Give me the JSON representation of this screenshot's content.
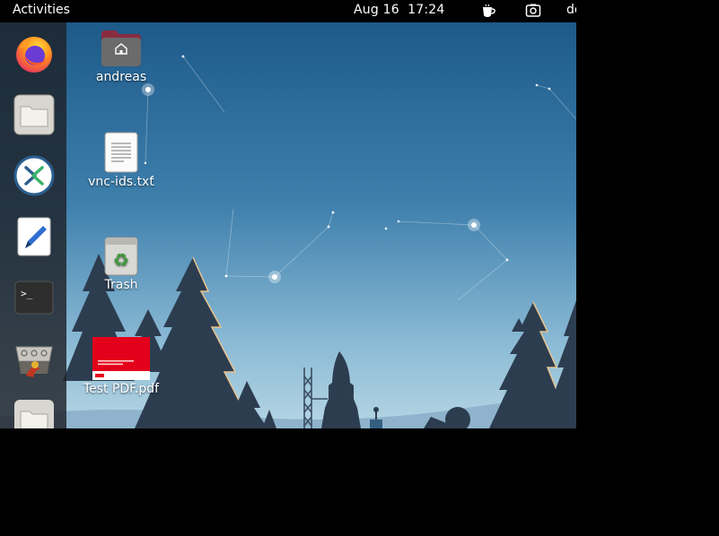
{
  "topbar": {
    "activities": "Activities",
    "date": "Aug 16",
    "time": "17:24",
    "user_menu": "de",
    "tray_icons": [
      "coffee-cup-icon",
      "screenshot-icon"
    ]
  },
  "dock": {
    "items": [
      "firefox-icon",
      "files-icon",
      "remote-desktop-icon",
      "text-editor-icon",
      "terminal-icon",
      "package-installer-icon",
      "folder-icon"
    ]
  },
  "desktop": {
    "icons": [
      {
        "label": "andreas",
        "icon": "home-folder-icon"
      },
      {
        "label": "vnc-ids.txt",
        "icon": "text-file-icon"
      },
      {
        "label": "Trash",
        "icon": "trash-icon"
      },
      {
        "label": "Test PDF.pdf",
        "icon": "pdf-thumbnail-icon"
      }
    ]
  },
  "colors": {
    "sky_top": "#1f5f8f",
    "sky_bottom": "#9fc6dc",
    "trees": "#2e3f52",
    "dock_bg": "#1e2228",
    "topbar_bg": "#000000",
    "pdf_red": "#e3001b"
  }
}
